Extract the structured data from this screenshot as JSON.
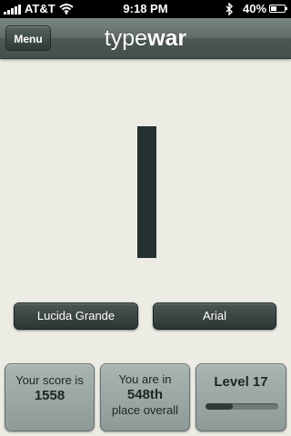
{
  "status_bar": {
    "carrier": "AT&T",
    "time": "9:18 PM",
    "battery_percent": "40%",
    "battery_level": 0.4,
    "signal_bars": 5,
    "icons": [
      "signal-icon",
      "wifi-icon",
      "bluetooth-icon",
      "battery-icon"
    ]
  },
  "nav_bar": {
    "menu_label": "Menu",
    "title_light": "type",
    "title_bold": "war"
  },
  "glyph": {
    "character": "l",
    "color": "#243030"
  },
  "choices": [
    {
      "label": "Lucida Grande"
    },
    {
      "label": "Arial"
    }
  ],
  "stats": {
    "score_label": "Your score is",
    "score_value": "1558",
    "rank_label": "You are in",
    "rank_value": "548th",
    "rank_suffix": "place overall",
    "level_label": "Level 17",
    "level_progress": 0.38
  },
  "colors": {
    "background": "#ecebe4",
    "nav": "#55615e",
    "button": "#3a4543",
    "panel": "#9aa7a4"
  }
}
